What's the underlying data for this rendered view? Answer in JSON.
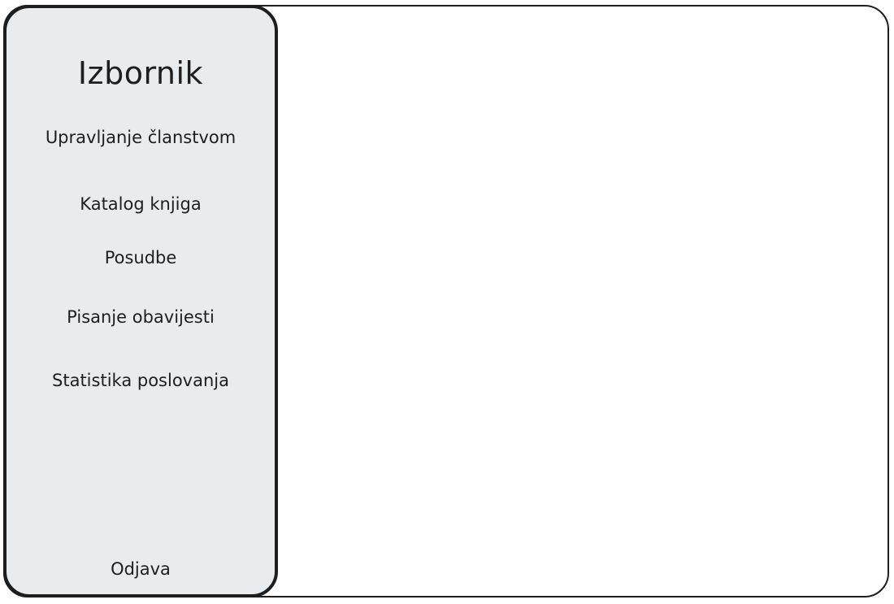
{
  "sidebar": {
    "title": "Izbornik",
    "items": [
      {
        "label": "Upravljanje članstvom"
      },
      {
        "label": "Katalog knjiga"
      },
      {
        "label": "Posudbe"
      },
      {
        "label": "Pisanje obavijesti"
      },
      {
        "label": "Statistika poslovanja"
      }
    ],
    "logout_label": "Odjava"
  },
  "colors": {
    "sidebar_bg": "#e9ecef",
    "border": "#1e1e1e",
    "content_bg": "#ffffff"
  }
}
